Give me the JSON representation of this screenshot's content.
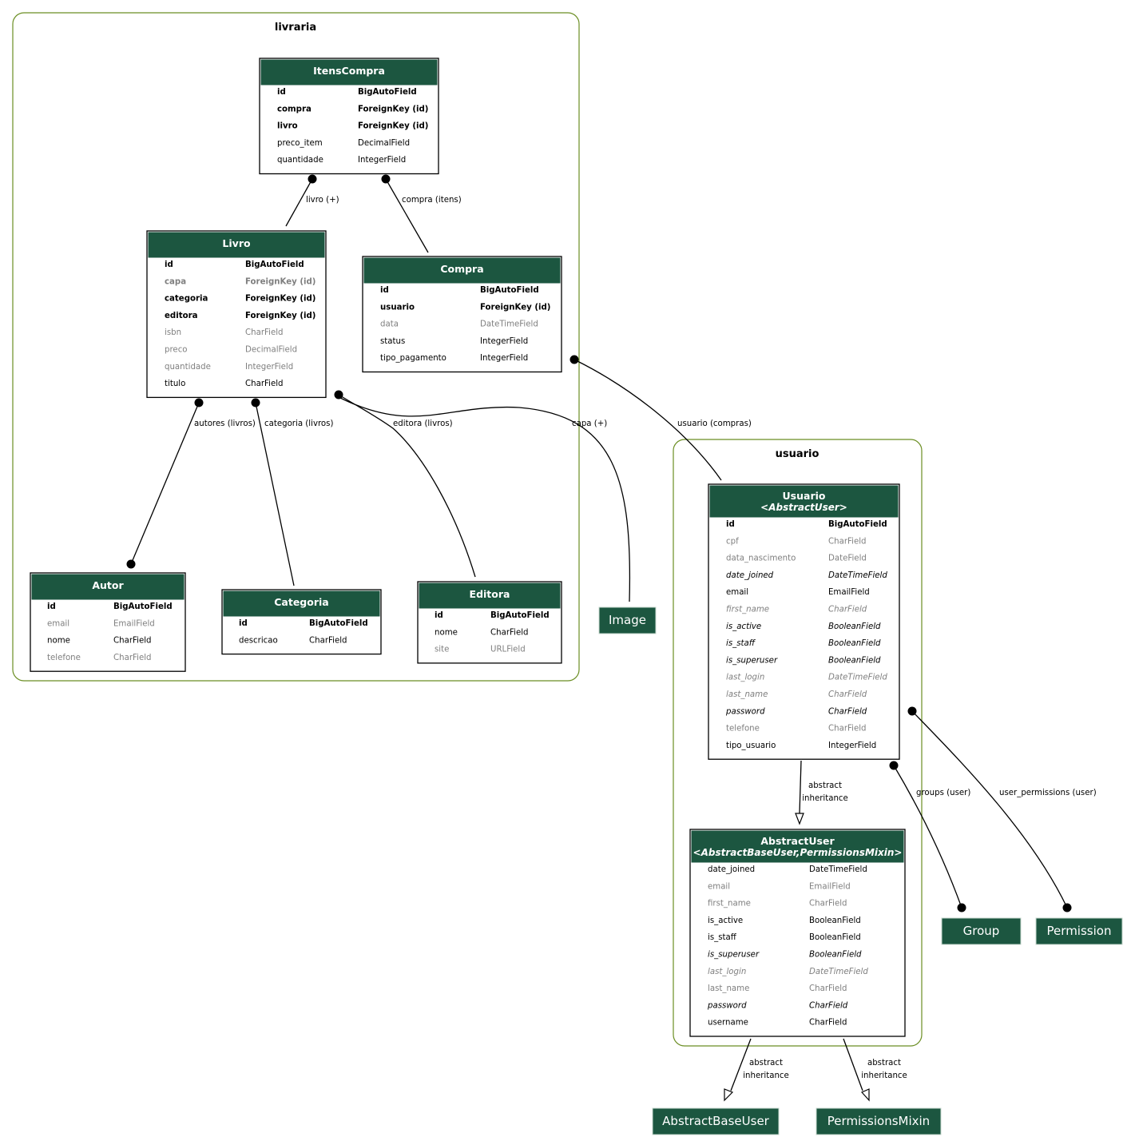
{
  "clusters": [
    {
      "id": "livraria",
      "label": "livraria"
    },
    {
      "id": "usuario",
      "label": "usuario"
    }
  ],
  "models": [
    {
      "id": "ItensCompra",
      "title": "ItensCompra",
      "subtitle": null,
      "fields": [
        {
          "name": "id",
          "type": "BigAutoField",
          "style": "bold"
        },
        {
          "name": "compra",
          "type": "ForeignKey (id)",
          "style": "bold"
        },
        {
          "name": "livro",
          "type": "ForeignKey (id)",
          "style": "bold"
        },
        {
          "name": "preco_item",
          "type": "DecimalField",
          "style": "normal"
        },
        {
          "name": "quantidade",
          "type": "IntegerField",
          "style": "normal"
        }
      ]
    },
    {
      "id": "Livro",
      "title": "Livro",
      "subtitle": null,
      "fields": [
        {
          "name": "id",
          "type": "BigAutoField",
          "style": "bold"
        },
        {
          "name": "capa",
          "type": "ForeignKey (id)",
          "style": "bold-gray"
        },
        {
          "name": "categoria",
          "type": "ForeignKey (id)",
          "style": "bold"
        },
        {
          "name": "editora",
          "type": "ForeignKey (id)",
          "style": "bold"
        },
        {
          "name": "isbn",
          "type": "CharField",
          "style": "gray"
        },
        {
          "name": "preco",
          "type": "DecimalField",
          "style": "gray"
        },
        {
          "name": "quantidade",
          "type": "IntegerField",
          "style": "gray"
        },
        {
          "name": "titulo",
          "type": "CharField",
          "style": "normal"
        }
      ]
    },
    {
      "id": "Compra",
      "title": "Compra",
      "subtitle": null,
      "fields": [
        {
          "name": "id",
          "type": "BigAutoField",
          "style": "bold"
        },
        {
          "name": "usuario",
          "type": "ForeignKey (id)",
          "style": "bold"
        },
        {
          "name": "data",
          "type": "DateTimeField",
          "style": "gray"
        },
        {
          "name": "status",
          "type": "IntegerField",
          "style": "normal"
        },
        {
          "name": "tipo_pagamento",
          "type": "IntegerField",
          "style": "normal"
        }
      ]
    },
    {
      "id": "Autor",
      "title": "Autor",
      "subtitle": null,
      "fields": [
        {
          "name": "id",
          "type": "BigAutoField",
          "style": "bold"
        },
        {
          "name": "email",
          "type": "EmailField",
          "style": "gray"
        },
        {
          "name": "nome",
          "type": "CharField",
          "style": "normal"
        },
        {
          "name": "telefone",
          "type": "CharField",
          "style": "gray"
        }
      ]
    },
    {
      "id": "Categoria",
      "title": "Categoria",
      "subtitle": null,
      "fields": [
        {
          "name": "id",
          "type": "BigAutoField",
          "style": "bold"
        },
        {
          "name": "descricao",
          "type": "CharField",
          "style": "normal"
        }
      ]
    },
    {
      "id": "Editora",
      "title": "Editora",
      "subtitle": null,
      "fields": [
        {
          "name": "id",
          "type": "BigAutoField",
          "style": "bold"
        },
        {
          "name": "nome",
          "type": "CharField",
          "style": "normal"
        },
        {
          "name": "site",
          "type": "URLField",
          "style": "gray"
        }
      ]
    },
    {
      "id": "Usuario",
      "title": "Usuario",
      "subtitle": "<AbstractUser>",
      "fields": [
        {
          "name": "id",
          "type": "BigAutoField",
          "style": "bold"
        },
        {
          "name": "cpf",
          "type": "CharField",
          "style": "gray"
        },
        {
          "name": "data_nascimento",
          "type": "DateField",
          "style": "gray"
        },
        {
          "name": "date_joined",
          "type": "DateTimeField",
          "style": "italic"
        },
        {
          "name": "email",
          "type": "EmailField",
          "style": "normal"
        },
        {
          "name": "first_name",
          "type": "CharField",
          "style": "italic-gray"
        },
        {
          "name": "is_active",
          "type": "BooleanField",
          "style": "italic"
        },
        {
          "name": "is_staff",
          "type": "BooleanField",
          "style": "italic"
        },
        {
          "name": "is_superuser",
          "type": "BooleanField",
          "style": "italic"
        },
        {
          "name": "last_login",
          "type": "DateTimeField",
          "style": "italic-gray"
        },
        {
          "name": "last_name",
          "type": "CharField",
          "style": "italic-gray"
        },
        {
          "name": "password",
          "type": "CharField",
          "style": "italic"
        },
        {
          "name": "telefone",
          "type": "CharField",
          "style": "gray"
        },
        {
          "name": "tipo_usuario",
          "type": "IntegerField",
          "style": "normal"
        }
      ]
    },
    {
      "id": "AbstractUser",
      "title": "AbstractUser",
      "subtitle": "<AbstractBaseUser,PermissionsMixin>",
      "fields": [
        {
          "name": "date_joined",
          "type": "DateTimeField",
          "style": "normal"
        },
        {
          "name": "email",
          "type": "EmailField",
          "style": "gray"
        },
        {
          "name": "first_name",
          "type": "CharField",
          "style": "gray"
        },
        {
          "name": "is_active",
          "type": "BooleanField",
          "style": "normal"
        },
        {
          "name": "is_staff",
          "type": "BooleanField",
          "style": "normal"
        },
        {
          "name": "is_superuser",
          "type": "BooleanField",
          "style": "italic"
        },
        {
          "name": "last_login",
          "type": "DateTimeField",
          "style": "italic-gray"
        },
        {
          "name": "last_name",
          "type": "CharField",
          "style": "gray"
        },
        {
          "name": "password",
          "type": "CharField",
          "style": "italic"
        },
        {
          "name": "username",
          "type": "CharField",
          "style": "normal"
        }
      ]
    }
  ],
  "external_models": [
    {
      "id": "Image",
      "label": "Image"
    },
    {
      "id": "Group",
      "label": "Group"
    },
    {
      "id": "Permission",
      "label": "Permission"
    },
    {
      "id": "AbstractBaseUser",
      "label": "AbstractBaseUser"
    },
    {
      "id": "PermissionsMixin",
      "label": "PermissionsMixin"
    }
  ],
  "edges": [
    {
      "id": "itenscompra-livro",
      "from": "ItensCompra",
      "to": "Livro",
      "label": [
        "livro (+)"
      ],
      "kind": "relation"
    },
    {
      "id": "itenscompra-compra",
      "from": "ItensCompra",
      "to": "Compra",
      "label": [
        "compra (itens)"
      ],
      "kind": "relation"
    },
    {
      "id": "livro-autor",
      "from": "Livro",
      "to": "Autor",
      "label": [
        "autores (livros)"
      ],
      "kind": "m2m"
    },
    {
      "id": "livro-categoria",
      "from": "Livro",
      "to": "Categoria",
      "label": [
        "categoria (livros)"
      ],
      "kind": "relation"
    },
    {
      "id": "livro-editora",
      "from": "Livro",
      "to": "Editora",
      "label": [
        "editora (livros)"
      ],
      "kind": "relation"
    },
    {
      "id": "livro-image",
      "from": "Livro",
      "to": "Image",
      "label": [
        "capa (+)"
      ],
      "kind": "relation"
    },
    {
      "id": "compra-usuario",
      "from": "Compra",
      "to": "Usuario",
      "label": [
        "usuario (compras)"
      ],
      "kind": "relation"
    },
    {
      "id": "usuario-abstractuser",
      "from": "Usuario",
      "to": "AbstractUser",
      "label": [
        "abstract",
        "inheritance"
      ],
      "kind": "inheritance"
    },
    {
      "id": "usuario-group",
      "from": "Usuario",
      "to": "Group",
      "label": [
        "groups (user)"
      ],
      "kind": "m2m"
    },
    {
      "id": "usuario-permission",
      "from": "Usuario",
      "to": "Permission",
      "label": [
        "user_permissions (user)"
      ],
      "kind": "m2m"
    },
    {
      "id": "abstractuser-abstractbaseuser",
      "from": "AbstractUser",
      "to": "AbstractBaseUser",
      "label": [
        "abstract",
        "inheritance"
      ],
      "kind": "inheritance"
    },
    {
      "id": "abstractuser-permissionsmixin",
      "from": "AbstractUser",
      "to": "PermissionsMixin",
      "label": [
        "abstract",
        "inheritance"
      ],
      "kind": "inheritance"
    }
  ],
  "colors": {
    "header": "#1c5640",
    "cluster_border": "#6b8e23",
    "text": "#000000",
    "muted_text": "#7f7f7f"
  }
}
